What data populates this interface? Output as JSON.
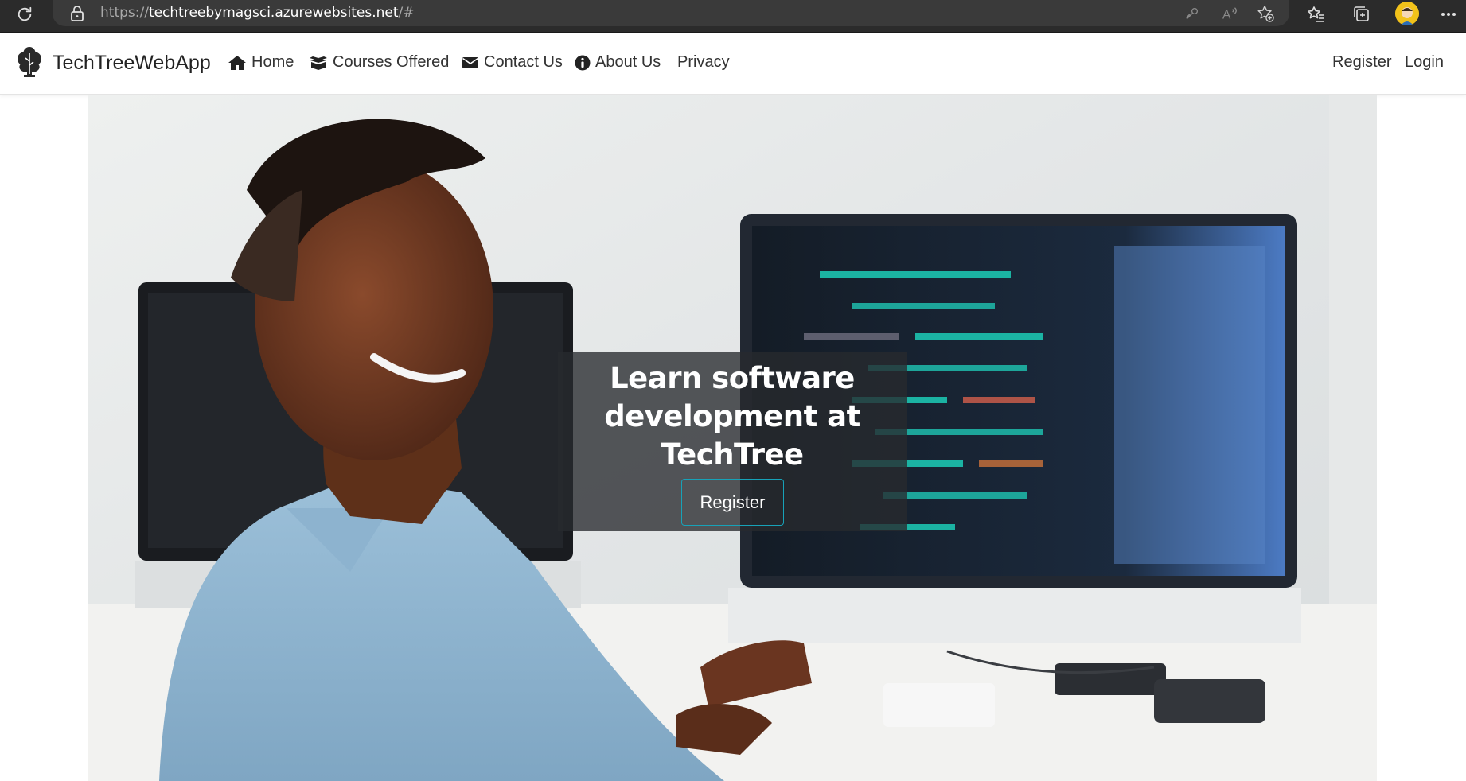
{
  "browser": {
    "url_protocol": "https://",
    "url_host": "techtreebymagsci.azurewebsites.net",
    "url_path": "/#"
  },
  "navbar": {
    "brand": "TechTreeWebApp",
    "items": [
      {
        "label": "Home",
        "icon": "home-icon"
      },
      {
        "label": "Courses Offered",
        "icon": "box-open-icon"
      },
      {
        "label": "Contact Us",
        "icon": "envelope-icon"
      },
      {
        "label": "About Us",
        "icon": "info-circle-icon"
      },
      {
        "label": "Privacy",
        "icon": ""
      }
    ],
    "register_label": "Register",
    "login_label": "Login"
  },
  "hero": {
    "title_line1": "Learn software",
    "title_line2": "development at",
    "title_line3": "TechTree",
    "button_label": "Register",
    "button_border_color": "#17a2b8"
  }
}
